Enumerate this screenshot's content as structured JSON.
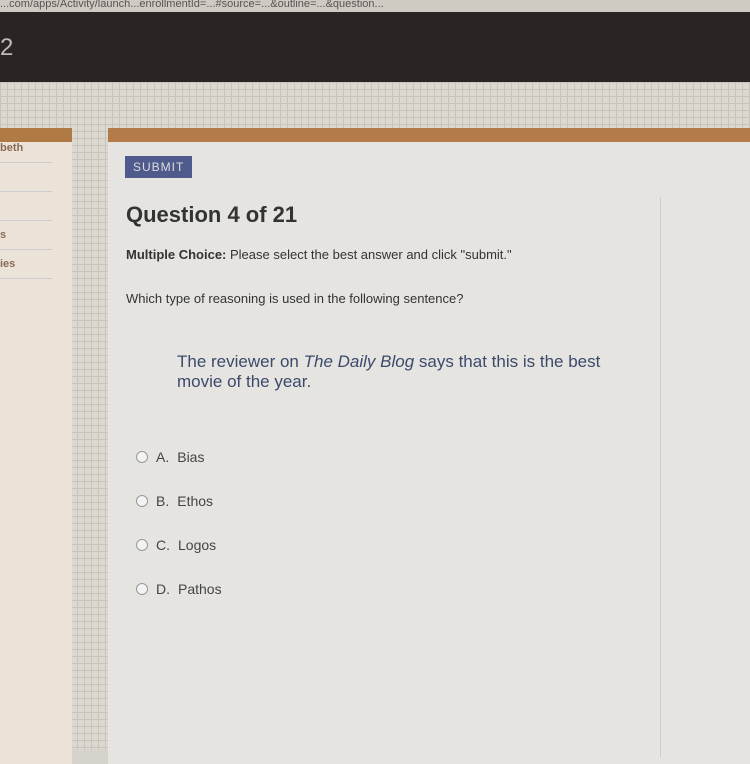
{
  "browser": {
    "url": "...com/apps/Activity/launch...enrollmentId=...#source=...&outline=...&question..."
  },
  "header": {
    "title_fragment": "2"
  },
  "sidebar": {
    "items": [
      "beth",
      "",
      "",
      "s",
      "ies"
    ]
  },
  "toolbar": {
    "submit_label": "SUBMIT"
  },
  "question": {
    "title": "Question 4 of 21",
    "type_label": "Multiple Choice:",
    "instruction": " Please select the best answer and click \"submit.\"",
    "prompt": "Which type of reasoning is used in the following sentence?",
    "passage_pre": "The reviewer on ",
    "passage_italic": "The Daily Blog",
    "passage_post": " says that this is the best movie of the year."
  },
  "options": [
    {
      "letter": "A.",
      "text": "Bias"
    },
    {
      "letter": "B.",
      "text": "Ethos"
    },
    {
      "letter": "C.",
      "text": "Logos"
    },
    {
      "letter": "D.",
      "text": "Pathos"
    }
  ]
}
